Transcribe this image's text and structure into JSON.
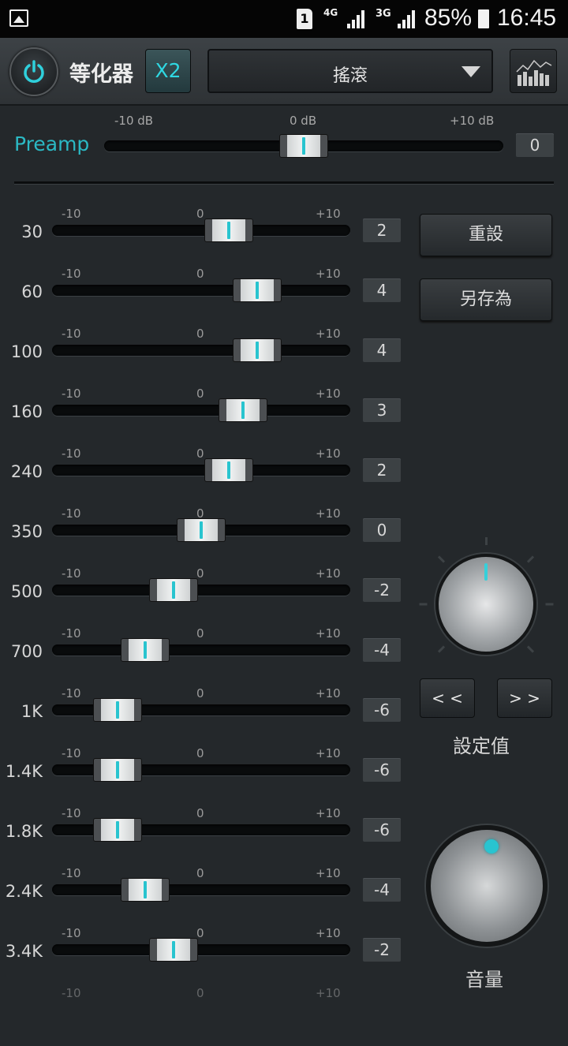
{
  "status_bar": {
    "sim_slot": "1",
    "network_4g": "4G",
    "network_3g": "3G",
    "battery_percent": "85%",
    "time": "16:45",
    "icons": [
      "image-icon",
      "sim-icon",
      "signal-icon",
      "battery-icon"
    ]
  },
  "header": {
    "title": "等化器",
    "x2_label": "X2",
    "preset_selected": "搖滾",
    "power_on": true,
    "accent_color": "#2bb9c4"
  },
  "preamp": {
    "label": "Preamp",
    "scale_min": "-10 dB",
    "scale_mid": "0 dB",
    "scale_max": "+10 dB",
    "value": 0
  },
  "band_scale": {
    "min": "-10",
    "mid": "0",
    "max": "+10"
  },
  "bands": [
    {
      "freq": "30",
      "value": 2
    },
    {
      "freq": "60",
      "value": 4
    },
    {
      "freq": "100",
      "value": 4
    },
    {
      "freq": "160",
      "value": 3
    },
    {
      "freq": "240",
      "value": 2
    },
    {
      "freq": "350",
      "value": 0
    },
    {
      "freq": "500",
      "value": -2
    },
    {
      "freq": "700",
      "value": -4
    },
    {
      "freq": "1K",
      "value": -6
    },
    {
      "freq": "1.4K",
      "value": -6
    },
    {
      "freq": "1.8K",
      "value": -6
    },
    {
      "freq": "2.4K",
      "value": -4
    },
    {
      "freq": "3.4K",
      "value": -2
    }
  ],
  "right_panel": {
    "reset_label": "重設",
    "save_as_label": "另存為",
    "prev_label": "< <",
    "next_label": "> >",
    "preset_knob_label": "設定值",
    "volume_label": "音量"
  }
}
